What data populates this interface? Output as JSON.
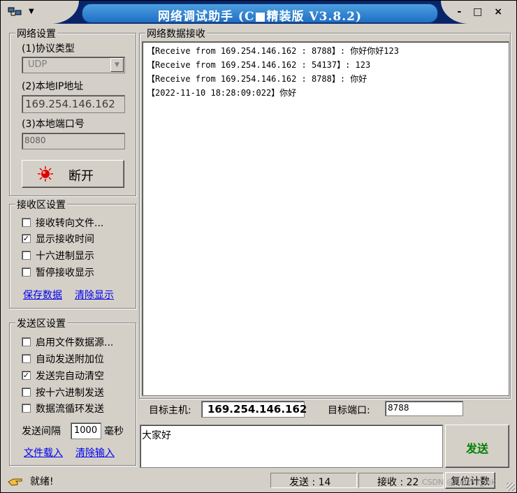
{
  "window": {
    "title": "网络调试助手 (C■精装版 V3.8.2)",
    "controls": "- □ ×"
  },
  "network_settings": {
    "group_title": "网络设置",
    "protocol_label": "(1)协议类型",
    "protocol_value": "UDP",
    "local_ip_label": "(2)本地IP地址",
    "local_ip_value": "169.254.146.162",
    "local_port_label": "(3)本地端口号",
    "local_port_value": "8080",
    "disconnect_label": "断开"
  },
  "receive_settings": {
    "group_title": "接收区设置",
    "options": [
      {
        "label": "接收转向文件...",
        "checked": false
      },
      {
        "label": "显示接收时间",
        "checked": true
      },
      {
        "label": "十六进制显示",
        "checked": false
      },
      {
        "label": "暂停接收显示",
        "checked": false
      }
    ],
    "save_data": "保存数据",
    "clear_display": "清除显示"
  },
  "send_settings": {
    "group_title": "发送区设置",
    "options": [
      {
        "label": "启用文件数据源...",
        "checked": false
      },
      {
        "label": "自动发送附加位",
        "checked": false
      },
      {
        "label": "发送完自动清空",
        "checked": true
      },
      {
        "label": "按十六进制发送",
        "checked": false
      },
      {
        "label": "数据流循环发送",
        "checked": false
      }
    ],
    "interval_label": "发送间隔",
    "interval_value": "1000",
    "interval_unit": "毫秒",
    "load_file": "文件载入",
    "clear_input": "清除输入"
  },
  "receive_area": {
    "title": "网络数据接收",
    "lines": [
      "【Receive from 169.254.146.162 : 8788】: 你好你好123",
      "【Receive from 169.254.146.162 : 54137】: 123",
      "【Receive from 169.254.146.162 : 8788】: 你好",
      "【2022-11-10 18:28:09:022】你好"
    ]
  },
  "target": {
    "host_label": "目标主机:",
    "host_value": "169.254.146.162",
    "port_label": "目标端口:",
    "port_value": "8788"
  },
  "send_area": {
    "text": "大家好",
    "send_button": "发送"
  },
  "status": {
    "ready": "就绪!",
    "sent_label": "发送 : 14",
    "received_label": "接收 : 22",
    "reset_button": "复位计数",
    "watermark": "CSDN @Hermit_Ink"
  },
  "colors": {
    "title_bar": "#0a246a",
    "title_pill": "#1f6fc4",
    "face": "#d4d0c8",
    "link": "#0000ee",
    "send_text": "#008000",
    "led": "#e00000"
  }
}
